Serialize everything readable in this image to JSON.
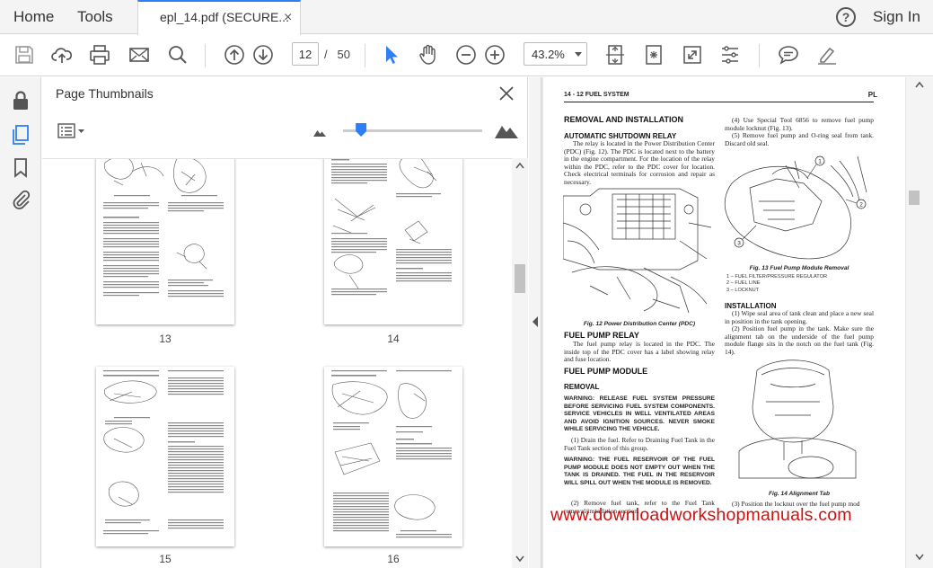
{
  "menubar": {
    "home": "Home",
    "tools": "Tools",
    "tab_title": "epl_14.pdf (SECURE...",
    "tab_close": "×",
    "help": "?",
    "sign_in": "Sign In"
  },
  "toolbar": {
    "current_page": "12",
    "page_separator": "/",
    "total_pages": "50",
    "zoom": "43.2%"
  },
  "thumbnails": {
    "title": "Page Thumbnails",
    "slider_fraction": 0.13,
    "pages": [
      {
        "number": "13"
      },
      {
        "number": "14"
      },
      {
        "number": "15"
      },
      {
        "number": "16"
      }
    ]
  },
  "document": {
    "header_left": "14 - 12     FUEL SYSTEM",
    "header_right": "PL",
    "h_removal_installation": "REMOVAL AND INSTALLATION",
    "h_asd_relay": "AUTOMATIC SHUTDOWN RELAY",
    "p_asd": "The relay is located in the Power Distribution Center (PDC) (Fig. 12). The PDC is located next to the battery in the engine compartment. For the location of the relay within the PDC, refer to the PDC cover for location. Check electrical terminals for corrosion and repair as necessary.",
    "fig12_caption": "Fig. 12 Power Distribution Center (PDC)",
    "h_fuel_pump_relay": "FUEL PUMP RELAY",
    "p_fuel_pump_relay": "The fuel pump relay is located in the PDC. The inside top of the PDC cover has a label showing relay and fuse location.",
    "h_fuel_pump_module": "FUEL PUMP MODULE",
    "h_removal": "REMOVAL",
    "warning1": "WARNING: RELEASE FUEL SYSTEM PRESSURE BEFORE SERVICING FUEL SYSTEM COMPONENTS. SERVICE VEHICLES IN WELL VENTILATED AREAS AND AVOID IGNITION SOURCES. NEVER SMOKE WHILE SERVICING THE VEHICLE.",
    "step1": "(1) Drain the fuel. Refer to Draining Fuel Tank in the Fuel Tank section of this group.",
    "warning2": "WARNING: THE FUEL RESERVOIR OF THE FUEL PUMP MODULE DOES NOT EMPTY OUT WHEN THE TANK IS DRAINED. THE FUEL IN THE RESERVOIR WILL SPILL OUT WHEN THE MODULE IS REMOVED.",
    "step2": "(2) Remove fuel tank, refer to the Fuel Tank removal/installation section.",
    "step4": "(4) Use Special Tool 6856 to remove fuel pump module locknut (Fig. 13).",
    "step5": "(5) Remove fuel pump and O-ring seal from tank. Discard old seal.",
    "fig13_caption": "Fig. 13 Fuel Pump Module Removal",
    "fig13_legend": [
      "1 – FUEL FILTER/PRESSURE REGULATOR",
      "2 – FUEL LINE",
      "3 – LOCKNUT"
    ],
    "h_installation": "INSTALLATION",
    "inst1": "(1) Wipe seal area of tank clean and place a new seal in position in the tank opening.",
    "inst2": "(2) Position fuel pump in the tank. Make sure the alignment tab on the underside of the fuel pump module flange sits in the notch on the fuel tank (Fig. 14).",
    "fig14_caption": "Fig. 14 Alignment Tab",
    "inst3": "(3) Position the locknut over the fuel pump mod",
    "callout_1": "1",
    "callout_2": "2",
    "callout_3": "3",
    "watermark": "www.downloadworkshopmanuals.com"
  }
}
